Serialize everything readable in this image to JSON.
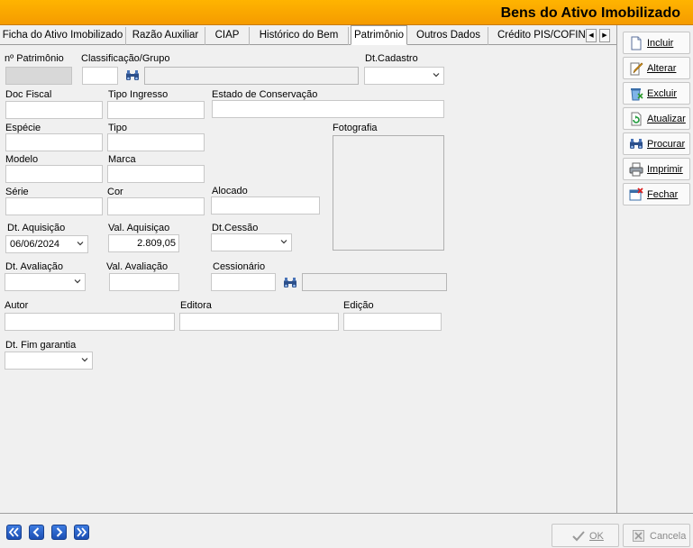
{
  "window": {
    "title": "Bens do Ativo Imobilizado"
  },
  "tabs": [
    {
      "label": "Ficha do Ativo Imobilizado"
    },
    {
      "label": "Razão Auxiliar"
    },
    {
      "label": "CIAP"
    },
    {
      "label": "Histórico do Bem"
    },
    {
      "label": "Patrimônio",
      "active": true
    },
    {
      "label": "Outros Dados"
    },
    {
      "label": "Crédito PIS/COFINS"
    }
  ],
  "form": {
    "patrimonio_label": "nº Patrimônio",
    "classificacao_label": "Classificação/Grupo",
    "dt_cadastro_label": "Dt.Cadastro",
    "doc_fiscal_label": "Doc Fiscal",
    "tipo_ingresso_label": "Tipo Ingresso",
    "estado_conservacao_label": "Estado de Conservação",
    "especie_label": "Espécie",
    "tipo_label": "Tipo",
    "fotografia_label": "Fotografia",
    "modelo_label": "Modelo",
    "marca_label": "Marca",
    "serie_label": "Série",
    "cor_label": "Cor",
    "alocado_label": "Alocado",
    "dt_aquisicao_label": "Dt. Aquisição",
    "dt_aquisicao_value": "06/06/2024",
    "val_aquisicao_label": "Val. Aquisiçao",
    "val_aquisicao_value": "2.809,05",
    "dt_cessao_label": "Dt.Cessão",
    "dt_avaliacao_label": "Dt. Avaliação",
    "val_avaliacao_label": "Val. Avaliação",
    "cessionario_label": "Cessionário",
    "autor_label": "Autor",
    "editora_label": "Editora",
    "edicao_label": "Edição",
    "dt_fim_garantia_label": "Dt. Fim garantia"
  },
  "sidebar": {
    "incluir": "Incluir",
    "alterar": "Alterar",
    "excluir": "Excluir",
    "atualizar": "Atualizar",
    "procurar": "Procurar",
    "imprimir": "Imprimir",
    "fechar": "Fechar"
  },
  "footer": {
    "ok": "OK",
    "cancela": "Cancela"
  },
  "colors": {
    "titlebar": "#f7a600",
    "nav_blue": "#2a5fcc"
  }
}
